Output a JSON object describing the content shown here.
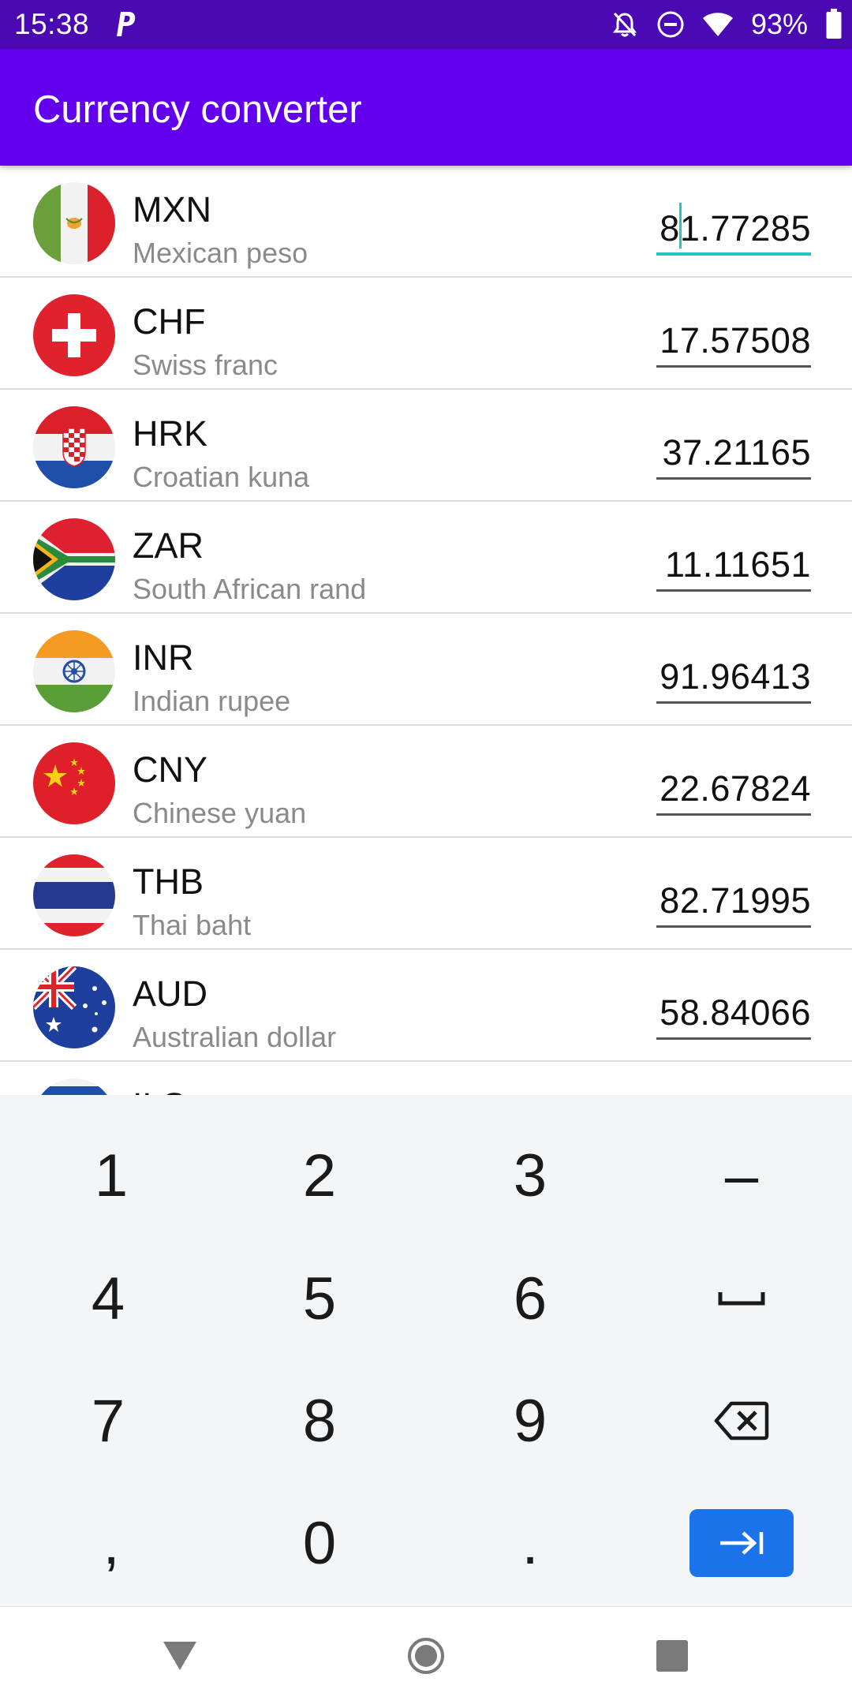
{
  "status_bar": {
    "time": "15:38",
    "battery": "93%",
    "icons": [
      "parking-badge-icon",
      "alarm-off-icon",
      "do-not-disturb-icon",
      "wifi-icon",
      "battery-icon"
    ]
  },
  "app_bar": {
    "title": "Currency converter",
    "color": "#6200ee"
  },
  "currencies": [
    {
      "code": "MXN",
      "name": "Mexican peso",
      "value": "81.77285",
      "flag": "mexico-flag-icon",
      "active": true
    },
    {
      "code": "CHF",
      "name": "Swiss franc",
      "value": "17.57508",
      "flag": "switzerland-flag-icon"
    },
    {
      "code": "HRK",
      "name": "Croatian kuna",
      "value": "37.21165",
      "flag": "croatia-flag-icon"
    },
    {
      "code": "ZAR",
      "name": "South African rand",
      "value": "11.11651",
      "flag": "south-africa-flag-icon"
    },
    {
      "code": "INR",
      "name": "Indian rupee",
      "value": "91.96413",
      "flag": "india-flag-icon"
    },
    {
      "code": "CNY",
      "name": "Chinese yuan",
      "value": "22.67824",
      "flag": "china-flag-icon"
    },
    {
      "code": "THB",
      "name": "Thai baht",
      "value": "82.71995",
      "flag": "thailand-flag-icon"
    },
    {
      "code": "AUD",
      "name": "Australian dollar",
      "value": "58.84066",
      "flag": "australia-flag-icon"
    },
    {
      "code": "ILS",
      "name": "",
      "value": "",
      "flag": "israel-flag-icon"
    }
  ],
  "keyboard": {
    "rows": [
      [
        "1",
        "2",
        "3",
        "–"
      ],
      [
        "4",
        "5",
        "6",
        "space"
      ],
      [
        "7",
        "8",
        "9",
        "backspace"
      ],
      [
        ",",
        "0",
        ".",
        "next"
      ]
    ],
    "accent": "#1a73e8"
  },
  "nav_bar": {
    "buttons": [
      "back-icon",
      "home-icon",
      "recents-icon"
    ]
  }
}
